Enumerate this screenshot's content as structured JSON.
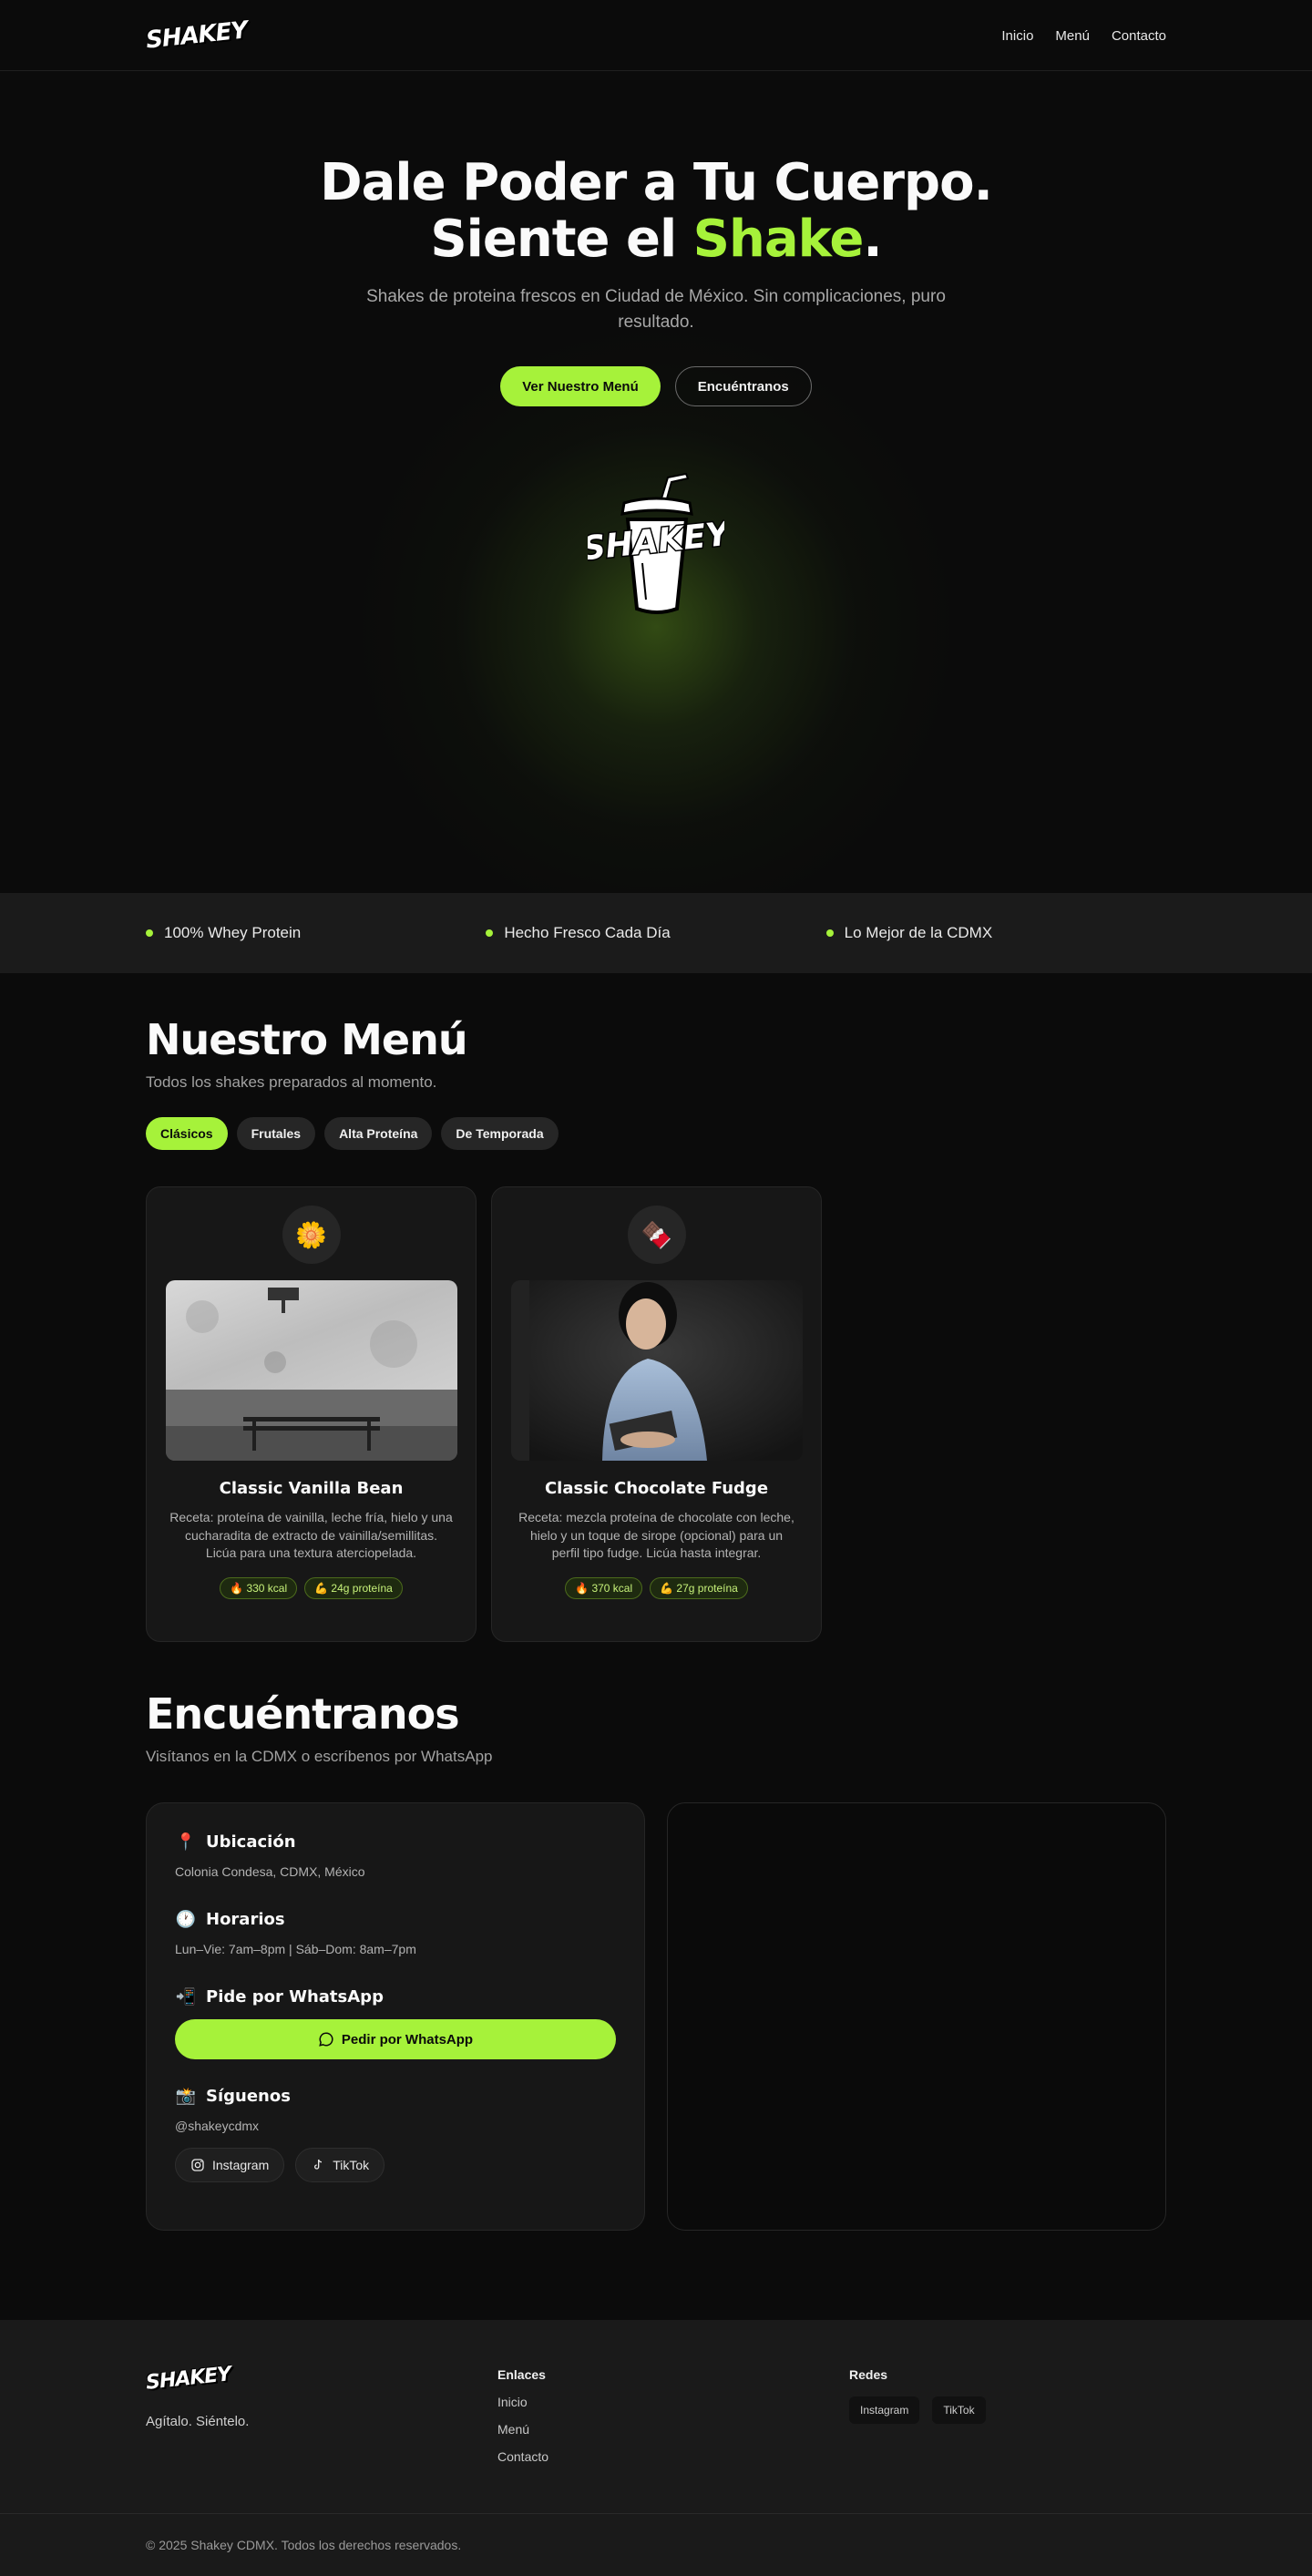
{
  "nav": {
    "logo": "SHAKEY",
    "links": [
      "Inicio",
      "Menú",
      "Contacto"
    ]
  },
  "hero": {
    "title_line1": "Dale Poder a Tu Cuerpo.",
    "title_line2_pre": "Siente el ",
    "title_line2_accent": "Shake",
    "title_line2_post": ".",
    "subtitle": "Shakes de proteina frescos en Ciudad de México. Sin complicaciones, puro resultado.",
    "primary_button": "Ver Nuestro Menú",
    "secondary_button": "Encuéntranos",
    "logo_text": "SHAKEY"
  },
  "features": [
    "100% Whey Protein",
    "Hecho Fresco Cada Día",
    "Lo Mejor de la CDMX"
  ],
  "menu": {
    "title": "Nuestro Menú",
    "subtitle": "Todos los shakes preparados al momento.",
    "filters": [
      {
        "label": "Clásicos",
        "active": true
      },
      {
        "label": "Frutales",
        "active": false
      },
      {
        "label": "Alta Proteína",
        "active": false
      },
      {
        "label": "De Temporada",
        "active": false
      }
    ],
    "items": [
      {
        "emoji": "🌼",
        "name": "Classic Vanilla Bean",
        "description": "Receta: proteína de vainilla, leche fría, hielo y una cucharadita de extracto de vainilla/semillitas. Licúa para una textura aterciopelada.",
        "kcal": "🔥 330 kcal",
        "protein": "💪 24g proteína"
      },
      {
        "emoji": "🍫",
        "name": "Classic Chocolate Fudge",
        "description": "Receta: mezcla proteína de chocolate con leche, hielo y un toque de sirope (opcional) para un perfil tipo fudge. Licúa hasta integrar.",
        "kcal": "🔥 370 kcal",
        "protein": "💪 27g proteína"
      }
    ]
  },
  "contact": {
    "title": "Encuéntranos",
    "subtitle": "Visítanos en la CDMX o escríbenos por WhatsApp",
    "location_heading": "Ubicación",
    "location_text": "Colonia Condesa, CDMX, México",
    "hours_heading": "Horarios",
    "hours_text": "Lun–Vie: 7am–8pm | Sáb–Dom: 8am–7pm",
    "whatsapp_heading": "Pide por WhatsApp",
    "whatsapp_button": "Pedir por WhatsApp",
    "follow_heading": "Síguenos",
    "handle": "@shakeycdmx",
    "instagram": "Instagram",
    "tiktok": "TikTok"
  },
  "footer": {
    "logo": "SHAKEY",
    "tagline": "Agítalo. Siéntelo.",
    "links_heading": "Enlaces",
    "links": [
      "Inicio",
      "Menú",
      "Contacto"
    ],
    "social_heading": "Redes",
    "social": [
      "Instagram",
      "TikTok"
    ],
    "copyright": "© 2025 Shakey CDMX. Todos los derechos reservados."
  },
  "colors": {
    "accent": "#a6f23a",
    "background": "#0b0b0b",
    "surface": "#171717"
  }
}
